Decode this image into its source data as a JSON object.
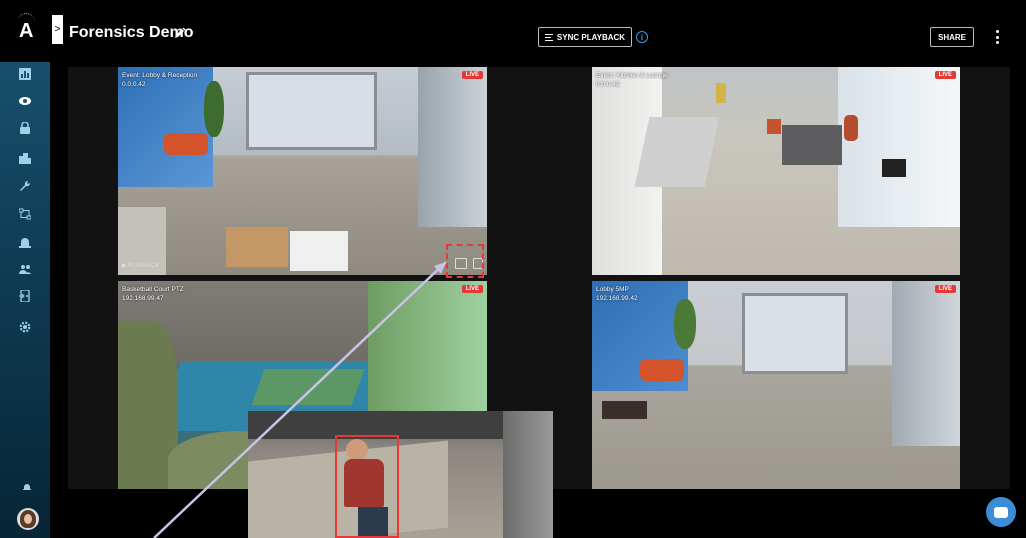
{
  "header": {
    "title": "Forensics Demo",
    "expand_symbol": ">",
    "sync_label": "SYNC PLAYBACK",
    "info_symbol": "i",
    "share_label": "SHARE"
  },
  "sidebar": {
    "logo": "A",
    "items": [
      {
        "icon": "dashboard-icon"
      },
      {
        "icon": "eye-icon"
      },
      {
        "icon": "lock-icon"
      },
      {
        "icon": "building-icon"
      },
      {
        "icon": "wrench-icon"
      },
      {
        "icon": "workflow-icon"
      },
      {
        "icon": "alarm-icon"
      },
      {
        "icon": "users-icon"
      },
      {
        "icon": "door-icon"
      },
      {
        "icon": "gear-icon"
      }
    ],
    "bottom": {
      "bell": "bell-icon",
      "avatar": "avatar"
    }
  },
  "cameras": [
    {
      "name": "Event: Lobby & Reception",
      "ip": "0.0.0.42",
      "status": "LIVE",
      "playback": "▶ PLAYBACK"
    },
    {
      "name": "Event: Kitchen & Lounge",
      "ip": "0.0.0.42",
      "status": "LIVE"
    },
    {
      "name": "Basketball Court PTZ",
      "ip": "192.168.99.47",
      "status": "LIVE"
    },
    {
      "name": "Lobby 5MP",
      "ip": "192.168.99.42",
      "status": "LIVE"
    }
  ],
  "colors": {
    "accent": "#3b9ae6",
    "live": "#e53935",
    "sidebar_top": "#1a5674",
    "sidebar_bottom": "#072535"
  }
}
